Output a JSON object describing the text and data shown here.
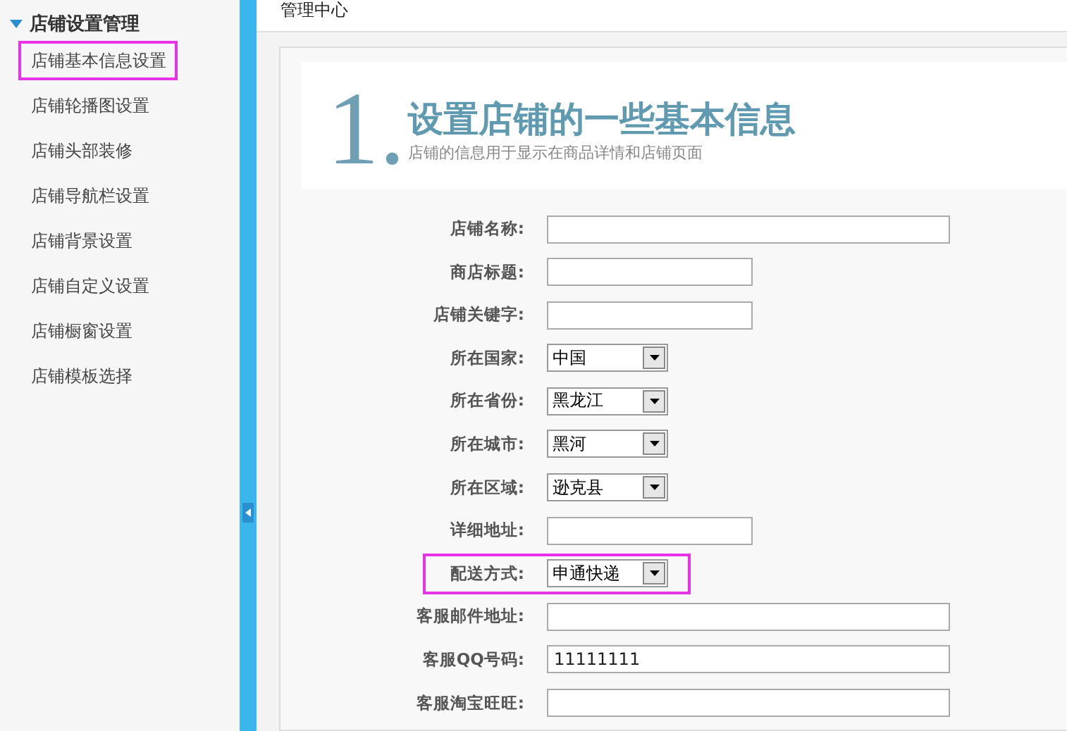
{
  "sidebar": {
    "title": "店铺设置管理",
    "expanded": true,
    "items": [
      {
        "label": "店铺基本信息设置",
        "highlighted": true
      },
      {
        "label": "店铺轮播图设置",
        "highlighted": false
      },
      {
        "label": "店铺头部装修",
        "highlighted": false
      },
      {
        "label": "店铺导航栏设置",
        "highlighted": false
      },
      {
        "label": "店铺背景设置",
        "highlighted": false
      },
      {
        "label": "店铺自定义设置",
        "highlighted": false
      },
      {
        "label": "店铺橱窗设置",
        "highlighted": false
      },
      {
        "label": "店铺模板选择",
        "highlighted": false
      }
    ]
  },
  "breadcrumb": "管理中心",
  "header": {
    "number": "1.",
    "title": "设置店铺的一些基本信息",
    "subtitle": "店铺的信息用于显示在商品详情和店铺页面"
  },
  "form": [
    {
      "label": "店铺名称:",
      "kind": "longtext",
      "highlighted": false
    },
    {
      "label": "商店标题:",
      "kind": "text",
      "highlighted": false
    },
    {
      "label": "店铺关键字:",
      "kind": "text",
      "highlighted": false
    },
    {
      "label": "所在国家:",
      "kind": "select",
      "value": "中国",
      "highlighted": false
    },
    {
      "label": "所在省份:",
      "kind": "select",
      "value": "黑龙江",
      "highlighted": false
    },
    {
      "label": "所在城市:",
      "kind": "select",
      "value": "黑河",
      "highlighted": false
    },
    {
      "label": "所在区域:",
      "kind": "select",
      "value": "逊克县",
      "highlighted": false
    },
    {
      "label": "详细地址:",
      "kind": "text",
      "highlighted": false
    },
    {
      "label": "配送方式:",
      "kind": "select",
      "value": "申通快递",
      "highlighted": true
    },
    {
      "label": "客服邮件地址:",
      "kind": "longtext",
      "highlighted": false
    },
    {
      "label": "客服QQ号码:",
      "kind": "longtext",
      "value": "11111111",
      "highlighted": false
    },
    {
      "label": "客服淘宝旺旺:",
      "kind": "longtext",
      "highlighted": false
    }
  ]
}
